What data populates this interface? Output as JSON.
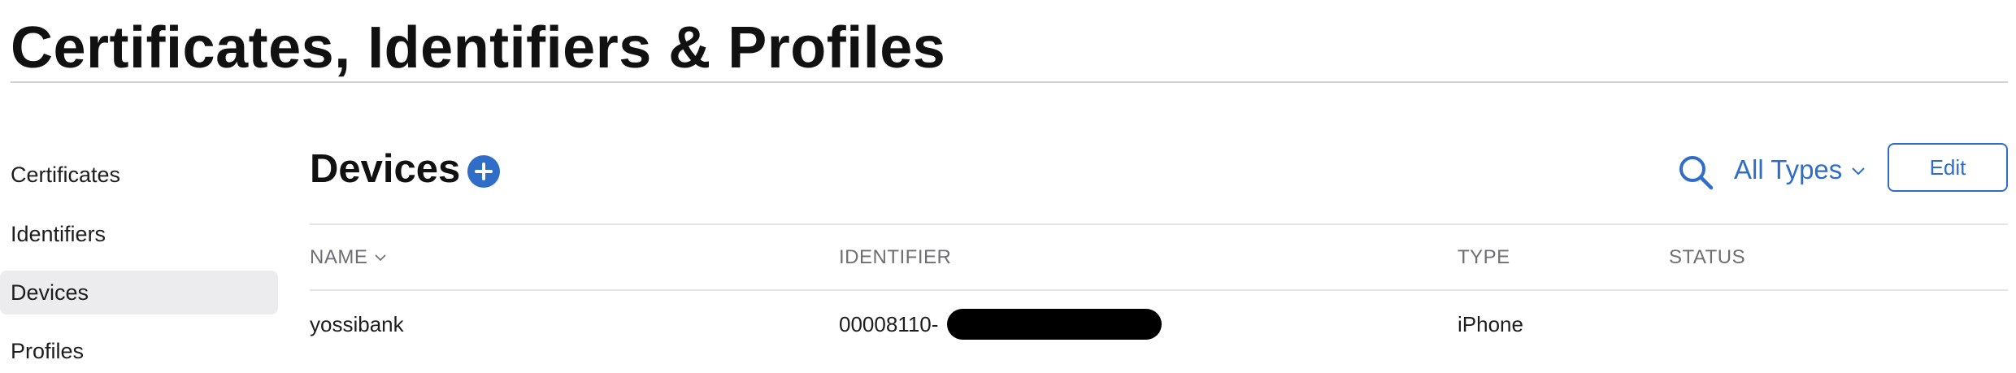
{
  "page": {
    "title": "Certificates, Identifiers & Profiles"
  },
  "sidebar": {
    "items": [
      {
        "label": "Certificates",
        "active": false
      },
      {
        "label": "Identifiers",
        "active": false
      },
      {
        "label": "Devices",
        "active": true
      },
      {
        "label": "Profiles",
        "active": false
      }
    ]
  },
  "main": {
    "heading": "Devices",
    "add_icon": "plus-circle-icon",
    "search_icon": "search-icon",
    "filter": {
      "selected": "All Types",
      "icon": "chevron-down-icon"
    },
    "edit_label": "Edit",
    "accent_color": "#2f6dc7",
    "table": {
      "columns": [
        {
          "label": "NAME",
          "sortable": true
        },
        {
          "label": "IDENTIFIER",
          "sortable": false
        },
        {
          "label": "TYPE",
          "sortable": false
        },
        {
          "label": "STATUS",
          "sortable": false
        }
      ],
      "rows": [
        {
          "name": "yossibank",
          "identifier": "00008110-",
          "identifier_redacted": true,
          "type": "iPhone",
          "status": ""
        }
      ]
    }
  }
}
